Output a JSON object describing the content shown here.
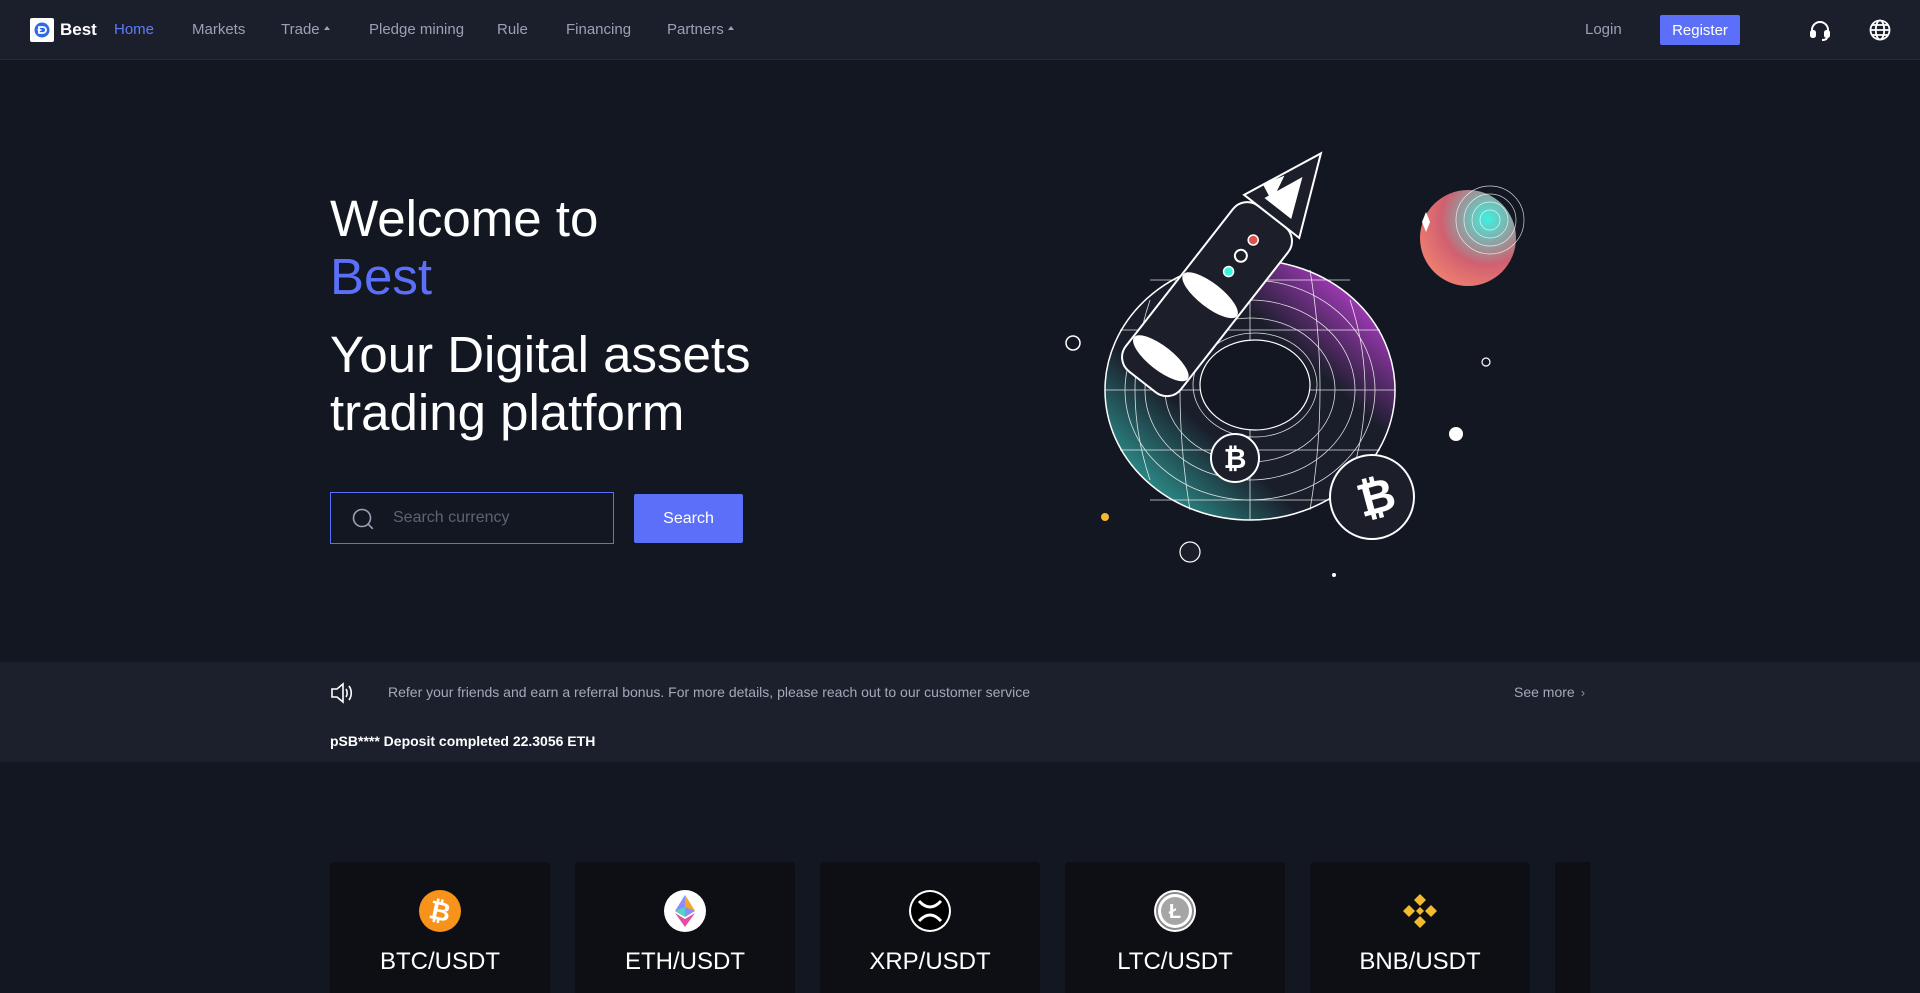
{
  "nav": {
    "brand": "Best",
    "items": [
      {
        "label": "Home",
        "active": true
      },
      {
        "label": "Markets",
        "dropdown": false
      },
      {
        "label": "Trade",
        "dropdown": true
      },
      {
        "label": "Pledge mining",
        "dropdown": false
      },
      {
        "label": "Rule",
        "dropdown": false
      },
      {
        "label": "Financing",
        "dropdown": false
      },
      {
        "label": "Partners",
        "dropdown": true
      }
    ],
    "login": "Login",
    "register": "Register",
    "icons": [
      "headset-icon",
      "globe-icon"
    ]
  },
  "hero": {
    "line1": "Welcome to",
    "line2": "Best",
    "line3": "Your Digital assets",
    "line4": "trading platform",
    "search_placeholder": "Search currency",
    "search_button": "Search"
  },
  "notice": {
    "text": "Refer your friends and earn a referral bonus. For more details, please reach out to our customer service",
    "see_more": "See more",
    "ticker": "pSB**** Deposit completed 22.3056 ETH"
  },
  "markets": [
    {
      "pair": "BTC/USDT",
      "icon": "bitcoin-icon",
      "color": "#f7931a"
    },
    {
      "pair": "ETH/USDT",
      "icon": "ethereum-icon",
      "color": "#ffffff"
    },
    {
      "pair": "XRP/USDT",
      "icon": "xrp-icon",
      "color": "#ffffff"
    },
    {
      "pair": "LTC/USDT",
      "icon": "litecoin-icon",
      "color": "#ffffff"
    },
    {
      "pair": "BNB/USDT",
      "icon": "bnb-icon",
      "color": "#f3ba2f"
    }
  ],
  "colors": {
    "accent": "#5c6ff8",
    "background": "#131722",
    "nav": "#1b1f2c"
  }
}
